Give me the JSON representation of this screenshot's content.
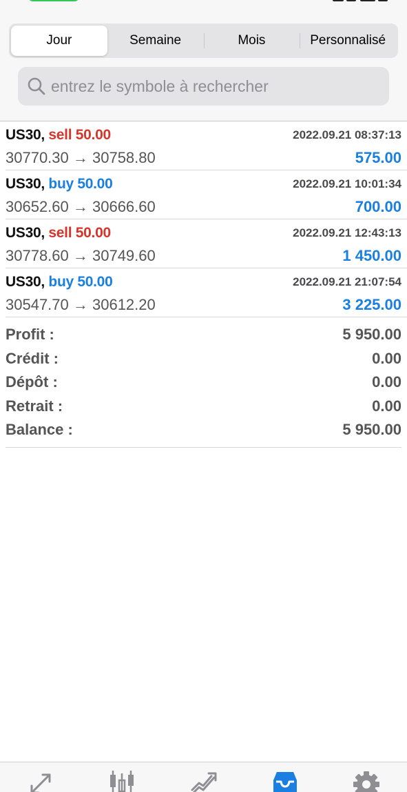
{
  "segments": [
    {
      "label": "Jour",
      "active": true
    },
    {
      "label": "Semaine",
      "active": false
    },
    {
      "label": "Mois",
      "active": false
    },
    {
      "label": "Personnalisé",
      "active": false
    }
  ],
  "search": {
    "placeholder": "entrez le symbole à rechercher",
    "icon": "search-icon"
  },
  "deals": [
    {
      "symbol": "US30,",
      "side": "sell",
      "volume": "sell 50.00",
      "time": "2022.09.21 08:37:13",
      "prices": "30770.30 → 30758.80",
      "profit": "575.00"
    },
    {
      "symbol": "US30,",
      "side": "buy",
      "volume": "buy 50.00",
      "time": "2022.09.21 10:01:34",
      "prices": "30652.60 → 30666.60",
      "profit": "700.00"
    },
    {
      "symbol": "US30,",
      "side": "sell",
      "volume": "sell 50.00",
      "time": "2022.09.21 12:43:13",
      "prices": "30778.60 → 30749.60",
      "profit": "1 450.00"
    },
    {
      "symbol": "US30,",
      "side": "buy",
      "volume": "buy 50.00",
      "time": "2022.09.21 21:07:54",
      "prices": "30547.70 → 30612.20",
      "profit": "3 225.00"
    }
  ],
  "summary": [
    {
      "label": "Profit :",
      "value": "5 950.00"
    },
    {
      "label": "Crédit :",
      "value": "0.00"
    },
    {
      "label": "Dépôt :",
      "value": "0.00"
    },
    {
      "label": "Retrait :",
      "value": "0.00"
    },
    {
      "label": "Balance :",
      "value": "5 950.00"
    }
  ],
  "colors": {
    "sell": "#d6352b",
    "buy": "#1a7fe0",
    "profit": "#1a7fe0",
    "active_tab": "#1a7fe0",
    "inactive_tab": "#8e8e93"
  },
  "tabbar": [
    {
      "icon": "quotes-icon",
      "active": false
    },
    {
      "icon": "chart-icon",
      "active": false
    },
    {
      "icon": "trade-icon",
      "active": false
    },
    {
      "icon": "history-icon",
      "active": true
    },
    {
      "icon": "settings-icon",
      "active": false
    }
  ]
}
